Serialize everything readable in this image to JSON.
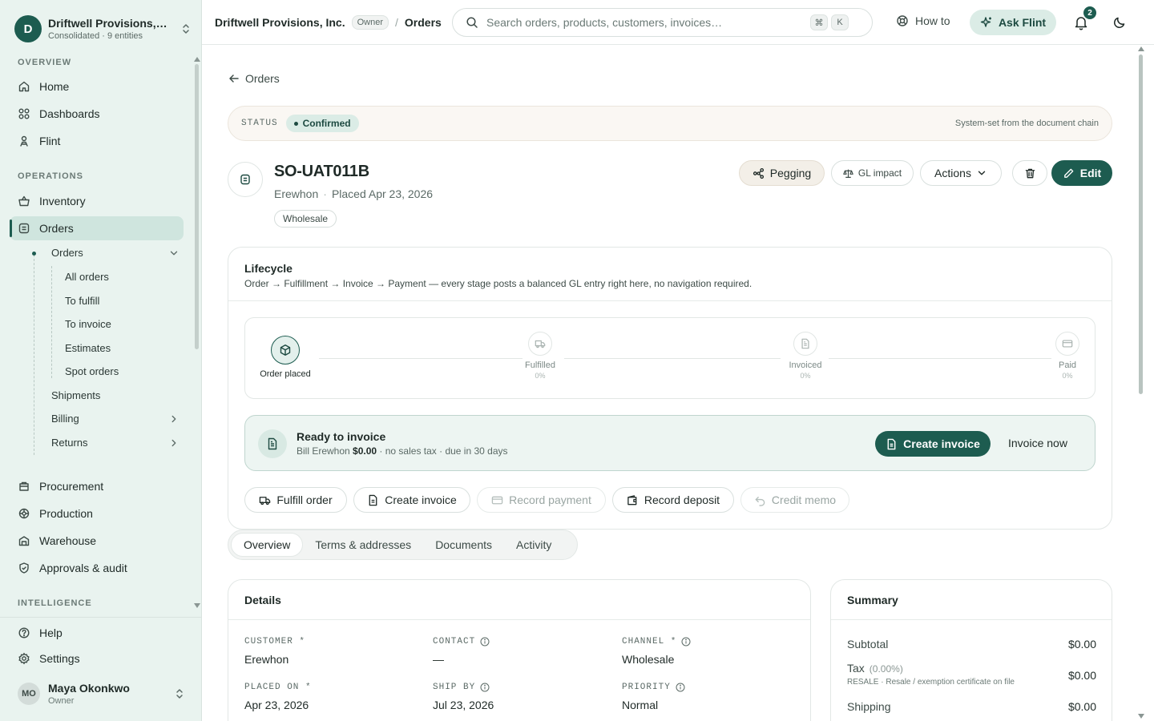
{
  "workspace": {
    "avatar": "D",
    "name": "Driftwell Provisions, Inc.",
    "subtitle": "Consolidated · 9 entities"
  },
  "sidebar": {
    "sections": {
      "overview": "OVERVIEW",
      "operations": "OPERATIONS",
      "intelligence": "INTELLIGENCE"
    },
    "overview_items": [
      {
        "label": "Home",
        "icon": "home-icon"
      },
      {
        "label": "Dashboards",
        "icon": "grid-icon"
      },
      {
        "label": "Flint",
        "icon": "flint-icon"
      }
    ],
    "operations_items": [
      {
        "label": "Inventory",
        "icon": "basket-icon"
      },
      {
        "label": "Orders",
        "icon": "receipt-icon",
        "active": true
      },
      {
        "label": "Procurement",
        "icon": "cart-icon"
      },
      {
        "label": "Production",
        "icon": "gear-icon"
      },
      {
        "label": "Warehouse",
        "icon": "warehouse-icon"
      },
      {
        "label": "Approvals & audit",
        "icon": "shield-icon"
      }
    ],
    "orders_sub": {
      "label": "Orders",
      "children": [
        "All orders",
        "To fulfill",
        "To invoice",
        "Estimates",
        "Spot orders"
      ]
    },
    "orders_more": [
      {
        "label": "Shipments",
        "expandable": false
      },
      {
        "label": "Billing",
        "expandable": true
      },
      {
        "label": "Returns",
        "expandable": true
      }
    ],
    "bottom_items": [
      {
        "label": "Help",
        "icon": "help-icon"
      },
      {
        "label": "Settings",
        "icon": "settings-icon"
      }
    ],
    "user": {
      "initials": "MO",
      "name": "Maya Okonkwo",
      "role": "Owner"
    }
  },
  "topbar": {
    "org": "Driftwell Provisions, Inc.",
    "role_badge": "Owner",
    "separator": "/",
    "current": "Orders",
    "search_placeholder": "Search orders, products, customers, invoices…",
    "kbd_cmd": "⌘",
    "kbd_k": "K",
    "how_to": "How to",
    "ask_flint": "Ask Flint",
    "notifications_count": "2"
  },
  "page": {
    "back_label": "Orders",
    "status_label": "STATUS",
    "status_value": "Confirmed",
    "status_note": "System-set from the document chain",
    "order_id": "SO-UAT011B",
    "customer": "Erewhon",
    "placed": "Placed Apr 23, 2026",
    "channel_chip": "Wholesale",
    "buttons": {
      "pegging": "Pegging",
      "gl_impact": "GL impact",
      "actions": "Actions",
      "edit": "Edit"
    }
  },
  "lifecycle": {
    "title": "Lifecycle",
    "description": "Order → Fulfillment → Invoice → Payment — every stage posts a balanced GL entry right here, no navigation required.",
    "steps": [
      {
        "label": "Order placed",
        "pct": "",
        "icon": "box-icon"
      },
      {
        "label": "Fulfilled",
        "pct": "0%",
        "icon": "truck-icon"
      },
      {
        "label": "Invoiced",
        "pct": "0%",
        "icon": "document-icon"
      },
      {
        "label": "Paid",
        "pct": "0%",
        "icon": "card-icon"
      }
    ],
    "ready": {
      "title": "Ready to invoice",
      "sub_prefix": "Bill Erewhon",
      "amount": "$0.00",
      "sub_suffix": "· no sales tax · due in 30 days",
      "primary": "Create invoice",
      "secondary": "Invoice now"
    },
    "actions": [
      {
        "label": "Fulfill order",
        "disabled": false
      },
      {
        "label": "Create invoice",
        "disabled": false
      },
      {
        "label": "Record payment",
        "disabled": true
      },
      {
        "label": "Record deposit",
        "disabled": false
      },
      {
        "label": "Credit memo",
        "disabled": true
      }
    ]
  },
  "tabs": [
    "Overview",
    "Terms & addresses",
    "Documents",
    "Activity"
  ],
  "details": {
    "title": "Details",
    "fields": [
      {
        "label": "CUSTOMER *",
        "value": "Erewhon"
      },
      {
        "label": "CONTACT",
        "value": "—"
      },
      {
        "label": "CHANNEL *",
        "value": "Wholesale"
      },
      {
        "label": "PLACED ON *",
        "value": "Apr 23, 2026"
      },
      {
        "label": "SHIP BY",
        "value": "Jul 23, 2026"
      },
      {
        "label": "PRIORITY",
        "value": "Normal"
      }
    ]
  },
  "summary": {
    "title": "Summary",
    "subtotal_label": "Subtotal",
    "subtotal": "$0.00",
    "tax_label": "Tax",
    "tax_pct": "(0.00%)",
    "tax": "$0.00",
    "tax_note": "RESALE · Resale / exemption certificate on file",
    "shipping_label": "Shipping",
    "shipping": "$0.00"
  },
  "colors": {
    "brand": "#1d5c50",
    "sidebar_bg": "#e9f3ef",
    "active_nav": "#cfe5de"
  }
}
